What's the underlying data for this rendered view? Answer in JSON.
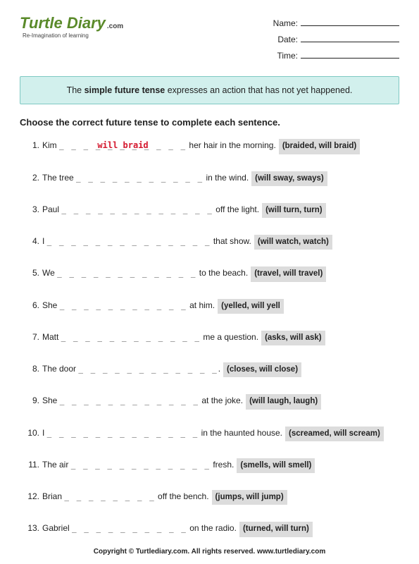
{
  "logo": {
    "main": "Turtle Diary",
    "dotcom": ".com",
    "tagline": "Re-Imagination of learning"
  },
  "info": {
    "name_label": "Name:",
    "date_label": "Date:",
    "time_label": "Time:"
  },
  "instruction": {
    "pre": "The ",
    "bold": "simple future tense",
    "post": " expresses an action that has not yet happened."
  },
  "directions": "Choose the correct future tense to complete each sentence.",
  "questions": [
    {
      "num": "1.",
      "pre": "Kim ",
      "blank": "_ _ _ _ _ _ _ _ _ _ _",
      "answer": "will braid",
      "post": " her hair in the morning.",
      "options": "(braided, will braid)"
    },
    {
      "num": "2.",
      "pre": "The tree ",
      "blank": "_ _ _ _ _ _ _ _ _ _ _",
      "answer": "",
      "post": " in the wind.",
      "options": "(will sway, sways)"
    },
    {
      "num": "3.",
      "pre": "Paul ",
      "blank": "_ _ _ _ _ _ _ _ _ _ _ _ _",
      "answer": "",
      "post": " off the light.",
      "options": "(will turn, turn)"
    },
    {
      "num": "4.",
      "pre": "I ",
      "blank": "_ _ _ _ _ _ _ _ _ _ _ _ _ _",
      "answer": "",
      "post": " that show.",
      "options": "(will watch, watch)"
    },
    {
      "num": "5.",
      "pre": "We ",
      "blank": "_ _ _ _ _ _ _ _ _ _ _ _",
      "answer": "",
      "post": " to the beach.",
      "options": "(travel, will travel)"
    },
    {
      "num": "6.",
      "pre": "She ",
      "blank": "_ _ _ _ _ _ _ _ _ _ _",
      "answer": "",
      "post": " at him.",
      "options": "(yelled, will yell"
    },
    {
      "num": "7.",
      "pre": "Matt ",
      "blank": "_ _ _ _ _ _ _ _ _ _ _ _",
      "answer": "",
      "post": " me a question.",
      "options": "(asks, will ask)"
    },
    {
      "num": "8.",
      "pre": "The door ",
      "blank": "_ _ _ _ _ _ _ _ _ _ _ _",
      "answer": "",
      "post": ".",
      "options": "(closes, will close)"
    },
    {
      "num": "9.",
      "pre": "She ",
      "blank": "_ _ _ _ _ _ _ _ _ _ _ _",
      "answer": "",
      "post": " at the joke.",
      "options": "(will laugh, laugh)"
    },
    {
      "num": "10.",
      "pre": "I ",
      "blank": "_ _ _ _ _ _ _ _ _ _ _ _ _",
      "answer": "",
      "post": " in the haunted house.",
      "options": "(screamed, will scream)"
    },
    {
      "num": "11.",
      "pre": "The air ",
      "blank": "_ _ _ _ _ _ _ _ _ _ _ _",
      "answer": "",
      "post": " fresh.",
      "options": "(smells, will smell)"
    },
    {
      "num": "12.",
      "pre": "Brian ",
      "blank": "_ _ _ _ _ _ _ _",
      "answer": "",
      "post": " off the bench.",
      "options": "(jumps, will jump)"
    },
    {
      "num": "13.",
      "pre": "Gabriel ",
      "blank": "_ _ _ _ _ _ _ _ _ _",
      "answer": "",
      "post": " on the radio.",
      "options": "(turned, will turn)"
    }
  ],
  "footer": "Copyright © Turtlediary.com. All rights reserved. www.turtlediary.com"
}
